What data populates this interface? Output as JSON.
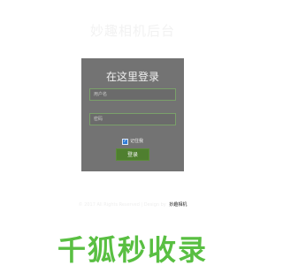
{
  "app": {
    "title": "妙趣相机后台"
  },
  "login_card": {
    "title": "在这里登录",
    "username": {
      "placeholder": "用户名",
      "value": ""
    },
    "password": {
      "placeholder": "密码",
      "value": ""
    },
    "remember_label": "记住我",
    "remember_checked": true,
    "login_button_label": "登录"
  },
  "footer": {
    "copyright": "© 2017 All Rights Reserved | Design by",
    "brand": "妙趣相机"
  },
  "watermark": {
    "text": "千狐秒收录"
  },
  "colors": {
    "card_background": "#737373",
    "field_border": "#7aa06a",
    "button_background": "#4f7f2f",
    "checkbox": "#2e7bd6",
    "watermark": "#59bf42"
  }
}
